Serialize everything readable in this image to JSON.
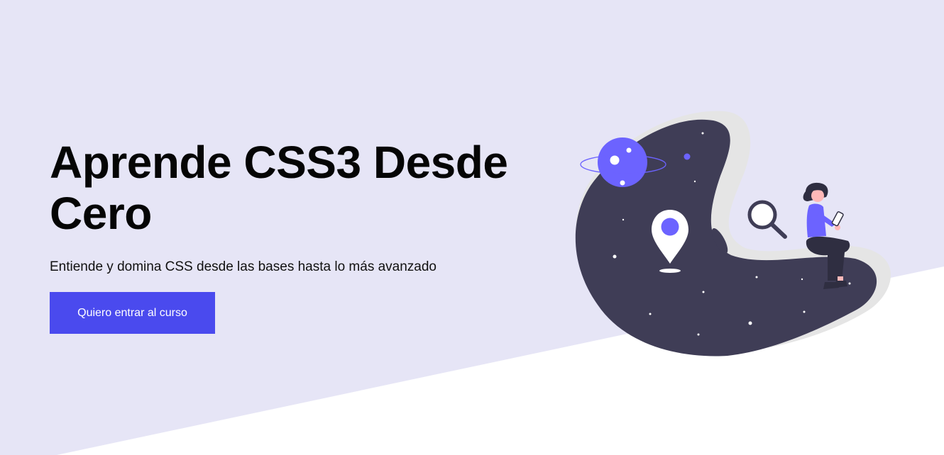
{
  "hero": {
    "title": "Aprende CSS3 Desde Cero",
    "subtitle": "Entiende y domina CSS desde las bases hasta lo más avanzado",
    "cta_label": "Quiero entrar al curso"
  },
  "colors": {
    "background": "#e6e5f6",
    "accent": "#4a4aee",
    "illustration_dark": "#3f3d56",
    "illustration_purple": "#6c63ff"
  },
  "illustration": {
    "icons": [
      "planet-icon",
      "location-pin-icon",
      "magnifier-icon",
      "person-with-phone-icon"
    ]
  }
}
